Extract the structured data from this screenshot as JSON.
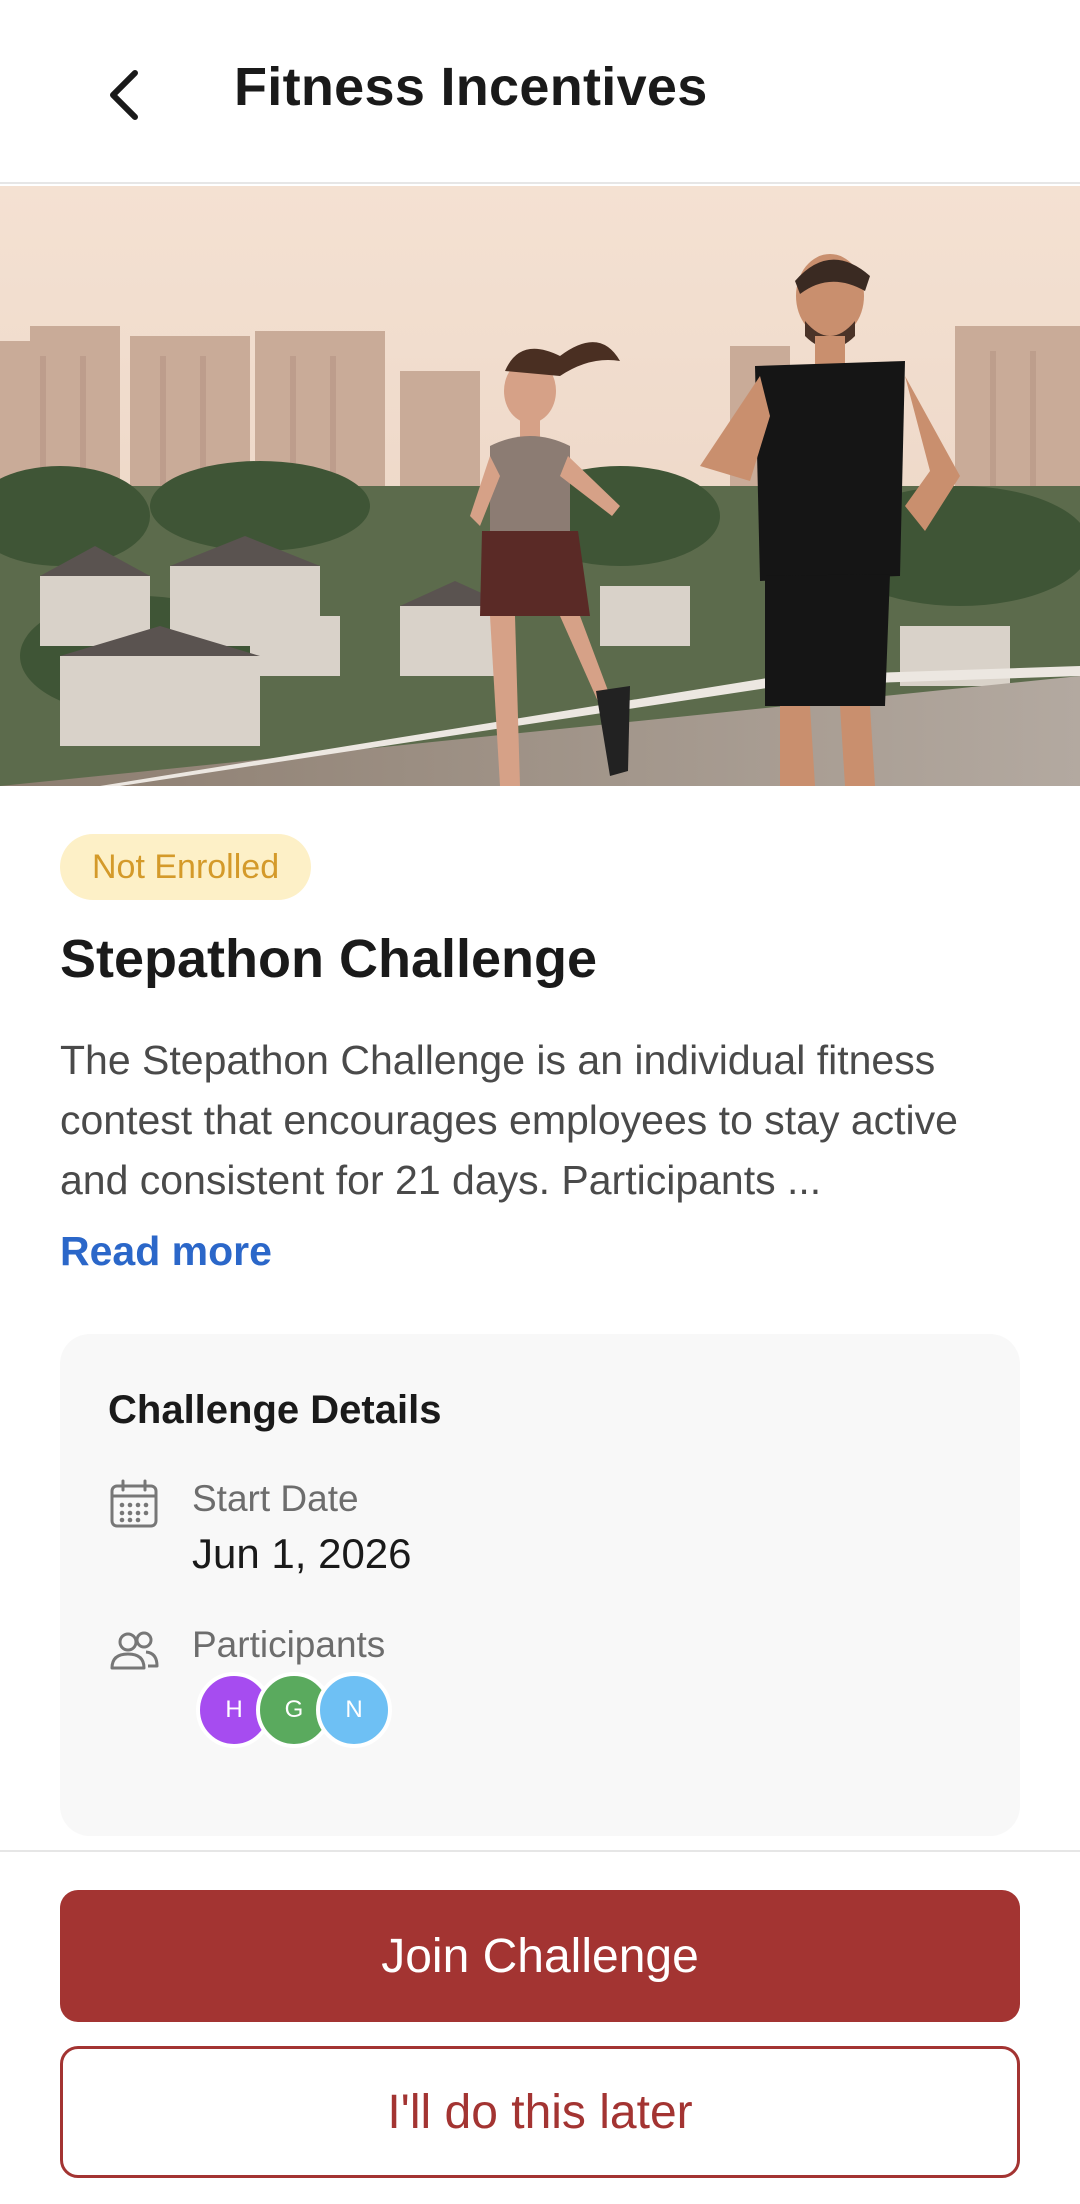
{
  "header": {
    "title": "Fitness Incentives",
    "back_icon": "chevron-left-icon"
  },
  "hero": {
    "image": "two-runners-rooftop-city-photo"
  },
  "challenge": {
    "status": "Not Enrolled",
    "title": "Stepathon Challenge",
    "description": "The Stepathon Challenge is an individual fitness contest that encourages employees to stay active and consistent for 21 days. Participants ...",
    "read_more": "Read more"
  },
  "details": {
    "heading": "Challenge Details",
    "start_date_label": "Start Date",
    "start_date_value": "Jun 1, 2026",
    "participants_label": "Participants",
    "participants": [
      {
        "initial": "H",
        "color": "#a64cf0"
      },
      {
        "initial": "G",
        "color": "#5aaa5e"
      },
      {
        "initial": "N",
        "color": "#6ec0f4"
      }
    ]
  },
  "actions": {
    "primary": "Join Challenge",
    "secondary": "I'll do this later"
  },
  "colors": {
    "brand": "#a33432",
    "link": "#2b67c9",
    "badge_bg": "#fdf0c7",
    "badge_text": "#d49a2a"
  }
}
